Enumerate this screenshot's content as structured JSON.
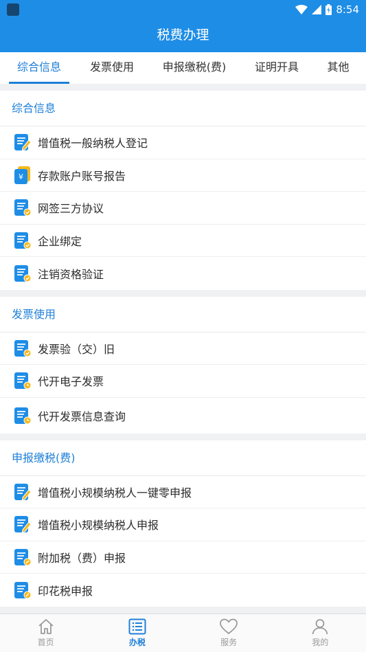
{
  "status_bar": {
    "time": "8:54"
  },
  "header": {
    "title": "税费办理"
  },
  "tabs": [
    {
      "label": "综合信息",
      "active": true
    },
    {
      "label": "发票使用"
    },
    {
      "label": "申报缴税(费)"
    },
    {
      "label": "证明开具"
    },
    {
      "label": "其他"
    }
  ],
  "sections": [
    {
      "title": "综合信息",
      "items": [
        {
          "label": "增值税一般纳税人登记",
          "icon": "document-edit-icon"
        },
        {
          "label": "存款账户账号报告",
          "icon": "yuan-card-icon"
        },
        {
          "label": "网签三方协议",
          "icon": "document-check-icon"
        },
        {
          "label": "企业绑定",
          "icon": "document-check-icon"
        },
        {
          "label": "注销资格验证",
          "icon": "document-check-icon"
        }
      ]
    },
    {
      "title": "发票使用",
      "items": [
        {
          "label": "发票验（交）旧",
          "icon": "document-check-icon"
        },
        {
          "label": "代开电子发票",
          "icon": "document-clock-icon"
        },
        {
          "label": "代开发票信息查询",
          "icon": "document-clock-icon"
        }
      ]
    },
    {
      "title": "申报缴税(费)",
      "items": [
        {
          "label": "增值税小规模纳税人一键零申报",
          "icon": "document-edit-icon"
        },
        {
          "label": "增值税小规模纳税人申报",
          "icon": "document-edit-icon"
        },
        {
          "label": "附加税（费）申报",
          "icon": "document-pen-badge-icon"
        },
        {
          "label": "印花税申报",
          "icon": "document-pen-badge-icon"
        }
      ]
    }
  ],
  "bottom_nav": [
    {
      "label": "首页",
      "icon": "home-icon"
    },
    {
      "label": "办税",
      "icon": "list-icon",
      "active": true
    },
    {
      "label": "服务",
      "icon": "heart-icon"
    },
    {
      "label": "我的",
      "icon": "user-icon"
    }
  ],
  "colors": {
    "primary": "#1e8de6",
    "accent": "#1e7fd8",
    "badge": "#f5b81c"
  }
}
